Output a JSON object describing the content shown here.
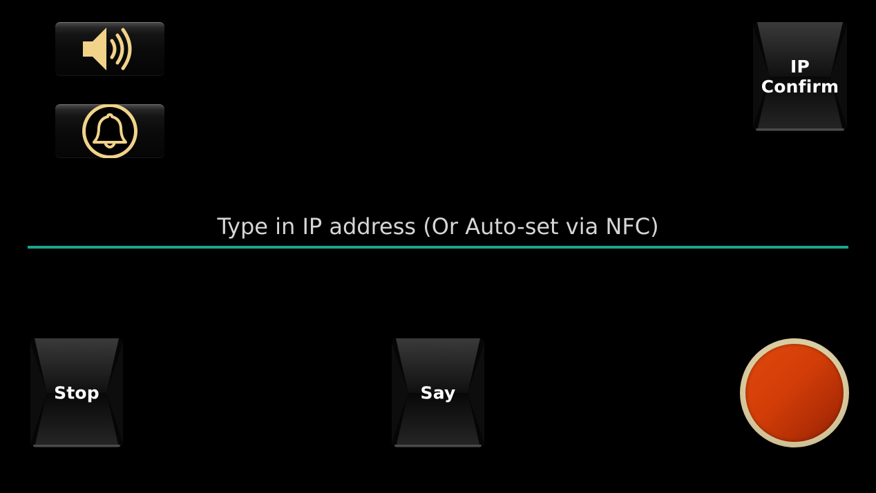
{
  "buttons": {
    "speaker_icon": "speaker-volume-icon",
    "bell_icon": "bell-icon",
    "ip_confirm_label": "IP Confirm",
    "stop_label": "Stop",
    "say_label": "Say"
  },
  "ip_input": {
    "value": "",
    "placeholder": "Type in IP address (Or Auto-set via NFC)"
  },
  "colors": {
    "background": "#000000",
    "accent_underline": "#1aa58f",
    "icon_gold": "#f1d38a",
    "record_red": "#d23d08",
    "record_ring": "#e4d6ad"
  }
}
